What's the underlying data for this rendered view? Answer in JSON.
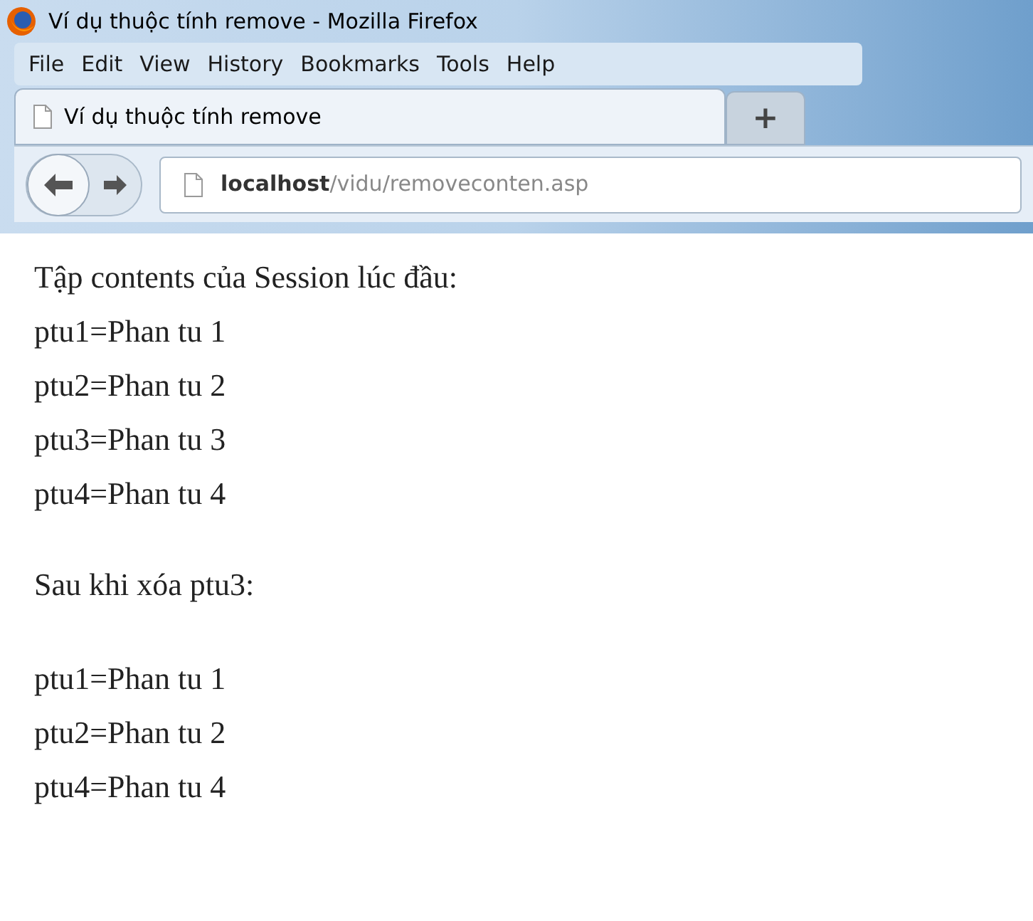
{
  "window": {
    "title": "Ví dụ thuộc tính remove - Mozilla Firefox"
  },
  "menu": [
    "File",
    "Edit",
    "View",
    "History",
    "Bookmarks",
    "Tools",
    "Help"
  ],
  "tabs": [
    {
      "label": "Ví dụ thuộc tính remove",
      "selected": true
    }
  ],
  "new_tab": "+",
  "address": {
    "host": "localhost",
    "path": "/vidu/removeconten.asp"
  },
  "content": [
    {
      "heading": "Tập contents của Session lúc đầu:",
      "lines": [
        "ptu1=Phan tu 1",
        "ptu2=Phan tu 2",
        "ptu3=Phan tu 3",
        "ptu4=Phan tu 4"
      ]
    },
    {
      "heading": "Sau khi xóa ptu3:",
      "lines": [
        "ptu1=Phan tu 1",
        "ptu2=Phan tu 2",
        "ptu4=Phan tu 4"
      ]
    }
  ]
}
